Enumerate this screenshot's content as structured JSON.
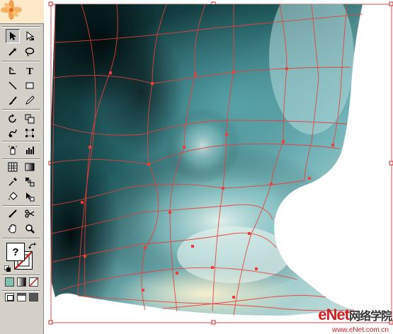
{
  "toolbox": {
    "tools": [
      {
        "name": "selection-tool",
        "selected": true
      },
      {
        "name": "direct-selection-tool"
      },
      {
        "name": "magic-wand-tool"
      },
      {
        "name": "lasso-tool"
      },
      {
        "name": "pen-tool"
      },
      {
        "name": "type-tool",
        "glyph": "T"
      },
      {
        "name": "line-segment-tool"
      },
      {
        "name": "rectangle-tool"
      },
      {
        "name": "paintbrush-tool"
      },
      {
        "name": "pencil-tool"
      },
      {
        "name": "rotate-tool"
      },
      {
        "name": "scale-tool"
      },
      {
        "name": "warp-tool"
      },
      {
        "name": "free-transform-tool"
      },
      {
        "name": "symbol-sprayer-tool"
      },
      {
        "name": "column-graph-tool"
      },
      {
        "name": "mesh-tool"
      },
      {
        "name": "gradient-tool"
      },
      {
        "name": "eyedropper-tool"
      },
      {
        "name": "blend-tool"
      },
      {
        "name": "live-paint-bucket-tool"
      },
      {
        "name": "live-paint-selection-tool"
      },
      {
        "name": "slice-tool"
      },
      {
        "name": "scissors-tool"
      },
      {
        "name": "hand-tool"
      },
      {
        "name": "zoom-tool"
      }
    ],
    "fill_stroke": {
      "fill_glyph": "?",
      "fill_color": "#ffffff",
      "stroke_color": "#d21e1e"
    },
    "mode_buttons": [
      "color-mode",
      "gradient-mode",
      "none-mode"
    ],
    "screen_buttons": [
      "standard-screen-mode",
      "full-screen-with-menu",
      "full-screen-mode"
    ]
  },
  "artwork": {
    "mesh_color": "#e8403a",
    "dark_color": "#0a2a2c",
    "teal_color": "#4e9aa0",
    "light_color": "#e9f3ee",
    "cream_color": "#f3eccb"
  },
  "watermark": {
    "brand": "eNet",
    "site": "网络学院",
    "sub": "www.eNet.com.cn"
  }
}
